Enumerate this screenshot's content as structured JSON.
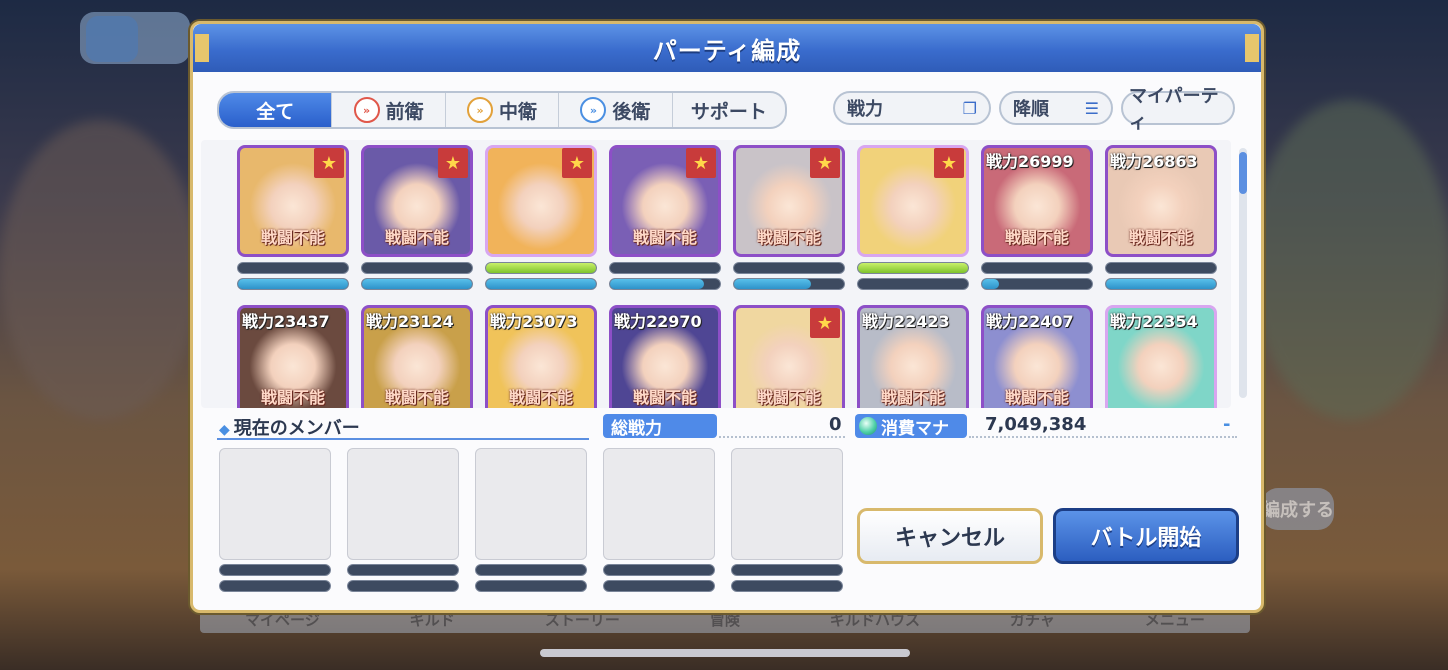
{
  "background": {
    "bottom_button_label": "編成する",
    "nav_items": [
      "マイページ",
      "ギルド",
      "ストーリー",
      "冒険",
      "ギルドハウス",
      "ガチャ",
      "メニュー"
    ]
  },
  "dialog": {
    "title": "パーティ編成"
  },
  "tabs": [
    {
      "label": "全て",
      "icon": ""
    },
    {
      "label": "前衛",
      "icon": "front-position-icon"
    },
    {
      "label": "中衛",
      "icon": "middle-position-icon"
    },
    {
      "label": "後衛",
      "icon": "back-position-icon"
    },
    {
      "label": "サポート",
      "icon": ""
    }
  ],
  "controls": {
    "sort_label": "戦力",
    "order_label": "降順",
    "my_party_label": "マイパーティ"
  },
  "characters": [
    {
      "power": "",
      "status": "戦闘不能",
      "star": true,
      "hp_full": false,
      "tp": 1.0,
      "tone": "#e8b86c",
      "hl": false
    },
    {
      "power": "",
      "status": "戦闘不能",
      "star": true,
      "hp_full": false,
      "tp": 1.0,
      "tone": "#6a5aa8",
      "hl": false
    },
    {
      "power": "",
      "status": "",
      "star": true,
      "hp_full": true,
      "tp": 1.0,
      "tone": "#f1b35a",
      "hl": true
    },
    {
      "power": "",
      "status": "戦闘不能",
      "star": true,
      "hp_full": false,
      "tp": 0.85,
      "tone": "#7a5fb5",
      "hl": false
    },
    {
      "power": "",
      "status": "戦闘不能",
      "star": true,
      "hp_full": false,
      "tp": 0.7,
      "tone": "#c9c3c8",
      "hl": false
    },
    {
      "power": "",
      "status": "",
      "star": true,
      "hp_full": true,
      "tp": 0.0,
      "tone": "#f1d27a",
      "hl": true
    },
    {
      "power": "戦力26999",
      "status": "戦闘不能",
      "star": false,
      "hp_full": false,
      "tp": 0.15,
      "tone": "#c96a78",
      "hl": false
    },
    {
      "power": "戦力26863",
      "status": "戦闘不能",
      "star": false,
      "hp_full": false,
      "tp": 1.0,
      "tone": "#e9c9b5",
      "hl": false
    },
    {
      "power": "戦力23437",
      "status": "戦闘不能",
      "star": false,
      "hp_full": false,
      "tp": 1.0,
      "tone": "#6b4a3f",
      "hl": false
    },
    {
      "power": "戦力23124",
      "status": "戦闘不能",
      "star": false,
      "hp_full": false,
      "tp": 1.0,
      "tone": "#c9a04a",
      "hl": false
    },
    {
      "power": "戦力23073",
      "status": "戦闘不能",
      "star": false,
      "hp_full": false,
      "tp": 1.0,
      "tone": "#f0c35a",
      "hl": false
    },
    {
      "power": "戦力22970",
      "status": "戦闘不能",
      "star": false,
      "hp_full": false,
      "tp": 1.0,
      "tone": "#4f4694",
      "hl": false
    },
    {
      "power": "",
      "status": "戦闘不能",
      "star": true,
      "hp_full": false,
      "tp": 1.0,
      "tone": "#f0d7a0",
      "hl": false
    },
    {
      "power": "戦力22423",
      "status": "戦闘不能",
      "star": false,
      "hp_full": false,
      "tp": 1.0,
      "tone": "#b8bcc8",
      "hl": false
    },
    {
      "power": "戦力22407",
      "status": "戦闘不能",
      "star": false,
      "hp_full": false,
      "tp": 1.0,
      "tone": "#8d8fd0",
      "hl": false
    },
    {
      "power": "戦力22354",
      "status": "",
      "star": false,
      "hp_full": false,
      "tp": 1.0,
      "tone": "#7fd6c8",
      "hl": true
    }
  ],
  "current_members": {
    "label": "現在のメンバー"
  },
  "total_power": {
    "label": "総戦力",
    "value": "0"
  },
  "mana": {
    "label": "消費マナ",
    "value": "7,049,384",
    "delta": "-"
  },
  "buttons": {
    "cancel": "キャンセル",
    "start": "バトル開始"
  }
}
